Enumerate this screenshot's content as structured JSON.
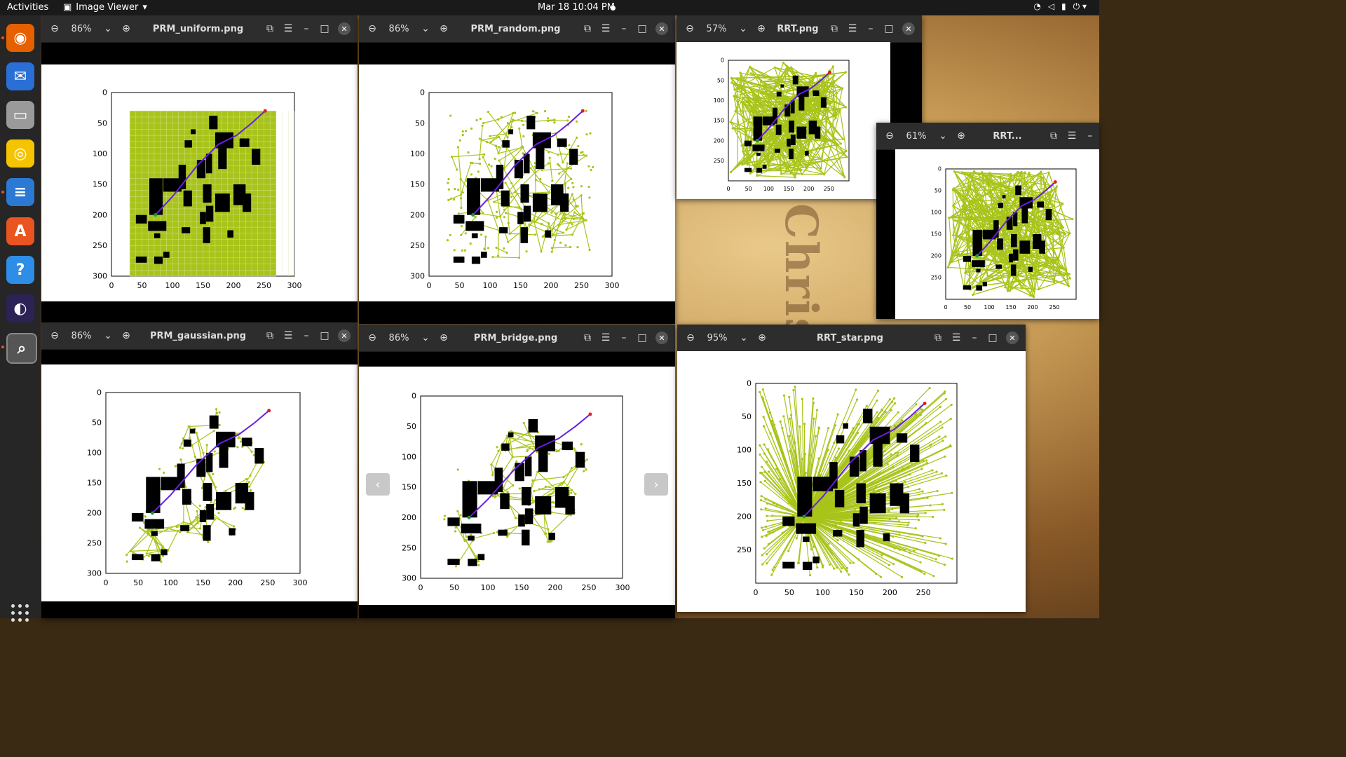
{
  "topbar": {
    "activities": "Activities",
    "app_name": "Image Viewer",
    "clock": "Mar 18  10:04 PM"
  },
  "wallpaper_text": "Christos",
  "dock": [
    {
      "name": "firefox-icon",
      "glyph": "◉",
      "color": "#e66000"
    },
    {
      "name": "thunderbird-icon",
      "glyph": "✉",
      "color": "#2a6fd6"
    },
    {
      "name": "files-icon",
      "glyph": "▭",
      "color": "#9a9a9a"
    },
    {
      "name": "rhythmbox-icon",
      "glyph": "◎",
      "color": "#f5c400"
    },
    {
      "name": "writer-icon",
      "glyph": "≡",
      "color": "#2b79d3"
    },
    {
      "name": "software-icon",
      "glyph": "A",
      "color": "#e95420"
    },
    {
      "name": "help-icon",
      "glyph": "?",
      "color": "#2e8de6"
    },
    {
      "name": "eclipse-icon",
      "glyph": "◐",
      "color": "#2c2255"
    },
    {
      "name": "image-viewer-icon",
      "glyph": "⌕",
      "color": "#4a4a4a"
    }
  ],
  "windows": [
    {
      "id": "prm-uniform",
      "zoom": "86%",
      "title": "PRM_uniform.png",
      "kind": "uniform",
      "xticks": [
        "0",
        "50",
        "100",
        "150",
        "200",
        "250",
        "300"
      ],
      "yticks": [
        "0",
        "50",
        "100",
        "150",
        "200",
        "250",
        "300"
      ]
    },
    {
      "id": "prm-random",
      "zoom": "86%",
      "title": "PRM_random.png",
      "kind": "random",
      "xticks": [
        "0",
        "50",
        "100",
        "150",
        "200",
        "250",
        "300"
      ],
      "yticks": [
        "0",
        "50",
        "100",
        "150",
        "200",
        "250",
        "300"
      ]
    },
    {
      "id": "rrt",
      "zoom": "57%",
      "title": "RRT.png",
      "kind": "rrt",
      "xticks": [
        "0",
        "50",
        "100",
        "150",
        "200",
        "250"
      ],
      "yticks": [
        "0",
        "50",
        "100",
        "150",
        "200",
        "250"
      ]
    },
    {
      "id": "rrt-small",
      "zoom": "61%",
      "title": "RRT...",
      "kind": "rrt",
      "xticks": [
        "0",
        "50",
        "100",
        "150",
        "200",
        "250"
      ],
      "yticks": [
        "0",
        "50",
        "100",
        "150",
        "200",
        "250"
      ]
    },
    {
      "id": "prm-gaussian",
      "zoom": "86%",
      "title": "PRM_gaussian.png",
      "kind": "gaussian",
      "xticks": [
        "0",
        "50",
        "100",
        "150",
        "200",
        "250",
        "300"
      ],
      "yticks": [
        "0",
        "50",
        "100",
        "150",
        "200",
        "250",
        "300"
      ]
    },
    {
      "id": "prm-bridge",
      "zoom": "86%",
      "title": "PRM_bridge.png",
      "kind": "bridge",
      "xticks": [
        "0",
        "50",
        "100",
        "150",
        "200",
        "250",
        "300"
      ],
      "yticks": [
        "0",
        "50",
        "100",
        "150",
        "200",
        "250",
        "300"
      ]
    },
    {
      "id": "rrt-star",
      "zoom": "95%",
      "title": "RRT_star.png",
      "kind": "rrtstar",
      "xticks": [
        "0",
        "50",
        "100",
        "150",
        "200",
        "250"
      ],
      "yticks": [
        "0",
        "50",
        "100",
        "150",
        "200",
        "250"
      ]
    }
  ],
  "colors": {
    "graph": "#a8c41a",
    "path": "#6a1de0",
    "obstacle": "#000000",
    "start": "#1a9a3a",
    "goal": "#e02020"
  }
}
